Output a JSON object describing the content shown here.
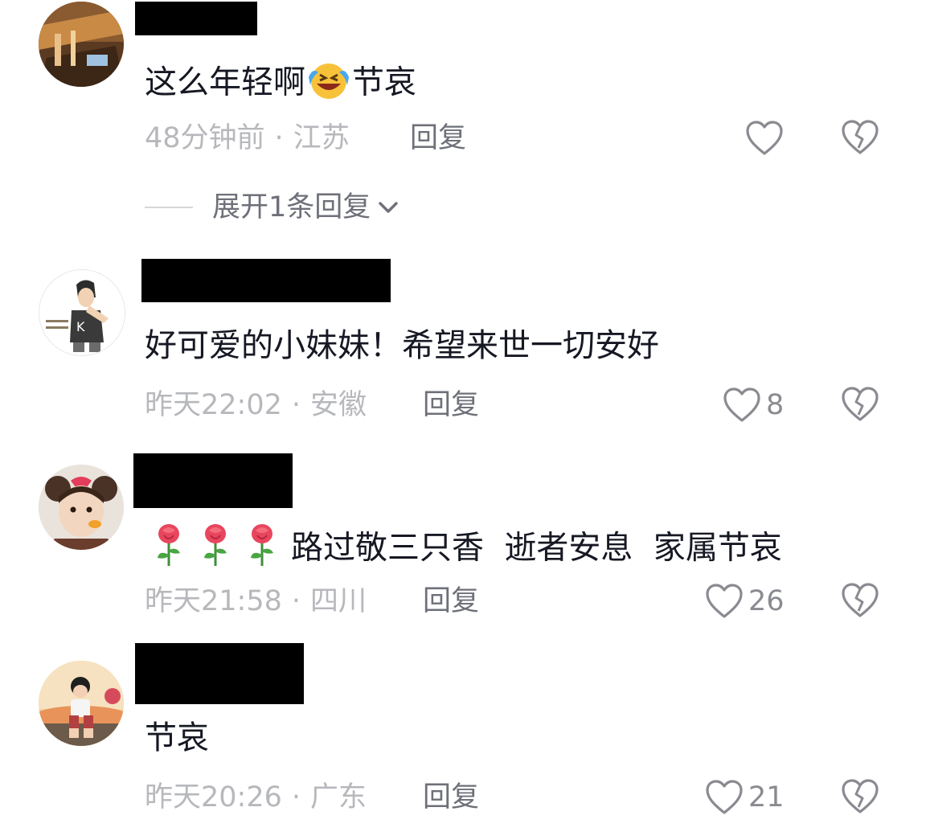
{
  "comments": [
    {
      "text_before": "这么年轻啊",
      "emoji": "grinning-squinting-tears-emoji",
      "text_after": "节哀",
      "time": "48分钟前",
      "region": "江苏",
      "reply_label": "回复",
      "likes": "",
      "expand_label": "展开1条回复"
    },
    {
      "text": "好可爱的小妹妹！希望来世一切安好",
      "time": "昨天22:02",
      "region": "安徽",
      "reply_label": "回复",
      "likes": "8"
    },
    {
      "roses": [
        "rose-emoji",
        "rose-emoji",
        "rose-emoji"
      ],
      "text": "路过敬三只香  逝者安息  家属节哀",
      "time": "昨天21:58",
      "region": "四川",
      "reply_label": "回复",
      "likes": "26"
    },
    {
      "text": "节哀",
      "time": "昨天20:26",
      "region": "广东",
      "reply_label": "回复",
      "likes": "21"
    }
  ],
  "meta_separator": "·",
  "icons": {
    "like": "heart-outline-icon",
    "dislike": "broken-heart-icon",
    "expand": "chevron-down-icon"
  },
  "colors": {
    "text": "#161823",
    "meta": "#b7b8bc",
    "reply": "#6e7079",
    "icon": "#8a8b91",
    "redaction": "#000000"
  }
}
